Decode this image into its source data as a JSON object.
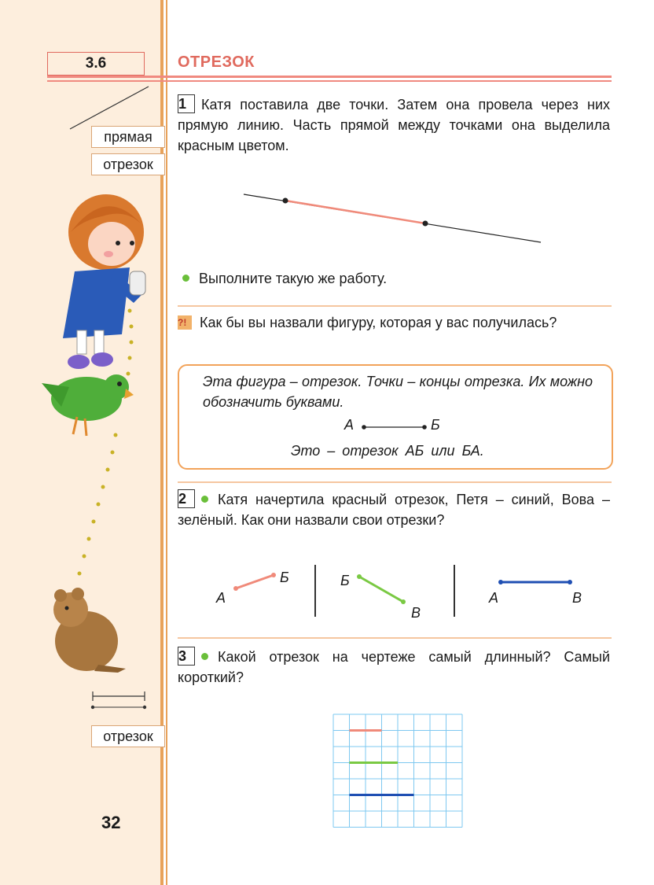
{
  "header": {
    "section_number": "3.6",
    "title": "ОТРЕЗОК"
  },
  "margin": {
    "term_line": "прямая",
    "term_segment_top": "отрезок",
    "term_segment_bottom": "отрезок",
    "page_number": "32"
  },
  "task1": {
    "number": "1",
    "text": "Катя поставила две точки. Затем она провела через них прямую линию. Часть прямой между точками она выделила красным цветом.",
    "instruction": "Выполните такую же работу."
  },
  "question": {
    "icon": "?!",
    "text": "Как бы вы назвали фигуру, которая у вас получилась?"
  },
  "rule_box": {
    "text": "Эта фигура – отрезок. Точки – концы отрезка. Их можно обозначить буквами.",
    "label_a": "А",
    "label_b": "Б",
    "line_prefix": "Это – отрезок",
    "name1": "АБ",
    "or": "или",
    "name2": "БА."
  },
  "task2": {
    "number": "2",
    "text": "Катя начертила красный отрезок, Петя – синий, Вова – зелёный. Как они назвали свои отрезки?",
    "segments": [
      {
        "color": "#f08a7a",
        "start": "А",
        "end": "Б"
      },
      {
        "color": "#7ac943",
        "start": "Б",
        "end": "В"
      },
      {
        "color": "#1f4fb3",
        "start": "А",
        "end": "В"
      }
    ]
  },
  "task3": {
    "number": "3",
    "text": "Какой отрезок на чертеже самый длинный? Самый короткий?",
    "grid_segments": [
      {
        "color": "#f08a7a",
        "cells": 2
      },
      {
        "color": "#7ac943",
        "cells": 3
      },
      {
        "color": "#1f4fb3",
        "cells": 4
      }
    ]
  },
  "colors": {
    "accent_red": "#e06a5e",
    "margin_bg": "#fdeedd",
    "rule": "#e8a25a",
    "grid": "#7ec8f0"
  }
}
